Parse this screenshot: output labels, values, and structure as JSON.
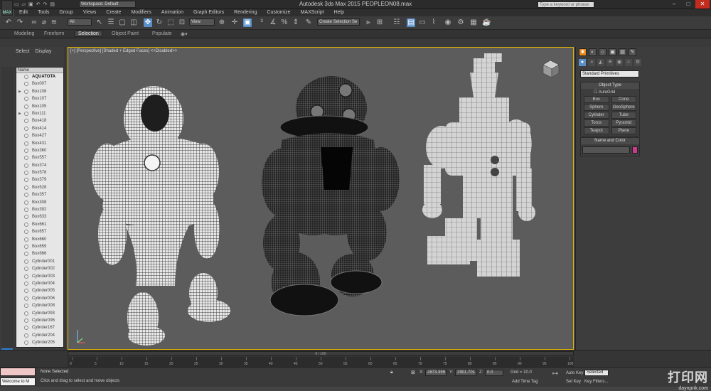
{
  "app": {
    "title": "Autodesk 3ds Max 2015    PEOPLEON08.max",
    "logo_text": "MAX",
    "workspace": "Workspace: Default",
    "search_placeholder": "Type a keyword or phrase",
    "window_buttons": [
      "–",
      "□",
      "✕"
    ]
  },
  "menu": [
    "Edit",
    "Tools",
    "Group",
    "Views",
    "Create",
    "Modifiers",
    "Animation",
    "Graph Editors",
    "Rendering",
    "Customize",
    "MAXScript",
    "Help"
  ],
  "toolbar": {
    "selection_filter": "All",
    "ref_coord": "View",
    "named_sel_placeholder": "Create Selection Se"
  },
  "ribbon_tabs": [
    "Modeling",
    "Freeform",
    "Selection",
    "Object Paint",
    "Populate"
  ],
  "ribbon_active": "Selection",
  "left_panel": {
    "tabs": [
      "Select",
      "Display"
    ],
    "header": "Name",
    "items": [
      "AQUATOTA",
      "Box007",
      "Box108",
      "Box107",
      "Box105",
      "Box111",
      "Box418",
      "Box414",
      "Box427",
      "Box431",
      "Box360",
      "Box557",
      "Box374",
      "Box578",
      "Box379",
      "Box528",
      "Box357",
      "Box308",
      "Box392",
      "Box633",
      "Box661",
      "Box657",
      "Box660",
      "Box659",
      "Box666",
      "Cylinder001",
      "Cylinder002",
      "Cylinder003",
      "Cylinder004",
      "Cylinder005",
      "Cylinder006",
      "Cylinder008",
      "Cylinder093",
      "Cylinder096",
      "Cylinder167",
      "Cylinder204",
      "Cylinder205"
    ]
  },
  "viewport": {
    "label": "[+] [Perspective] [Shaded + Edged Faces] <<Disabled>>",
    "border_color": "#e6b800"
  },
  "command_panel": {
    "tabs": [
      "✱",
      "◐",
      "⌂",
      "▣",
      "▤",
      "✎"
    ],
    "subtabs": [
      "●",
      "◑",
      "◭",
      "✳",
      "◉",
      "≈",
      "⚙"
    ],
    "category": "Standard Primitives",
    "object_type_title": "Object Type",
    "autogrid": "AutoGrid",
    "objects": [
      "Box",
      "Cone",
      "Sphere",
      "GeoSphere",
      "Cylinder",
      "Tube",
      "Torus",
      "Pyramid",
      "Teapot",
      "Plane"
    ],
    "name_color_title": "Name and Color",
    "color_swatch": "#cc3a8c"
  },
  "timeline": {
    "frame": "0 / 100",
    "ticks": [
      "0",
      "5",
      "10",
      "15",
      "20",
      "25",
      "30",
      "35",
      "40",
      "45",
      "50",
      "55",
      "60",
      "65",
      "70",
      "75",
      "80",
      "85",
      "90",
      "95",
      "100"
    ]
  },
  "status": {
    "listener_label": "Welcome to M",
    "selection": "None Selected",
    "prompt": "Click and drag to select and move objects",
    "x_label": "X:",
    "x": "2873.399",
    "y_label": "Y:",
    "y": "2901.701",
    "z_label": "Z:",
    "z": "0.0",
    "grid": "Grid = 10.0",
    "auto_key": "Auto Key",
    "set_key": "Set Key",
    "selected": "Selected",
    "key_filters": "Key Filters...",
    "add_time_tag": "Add Time Tag"
  },
  "watermark": {
    "main": "打印网",
    "sub": "daynpnk.com"
  }
}
